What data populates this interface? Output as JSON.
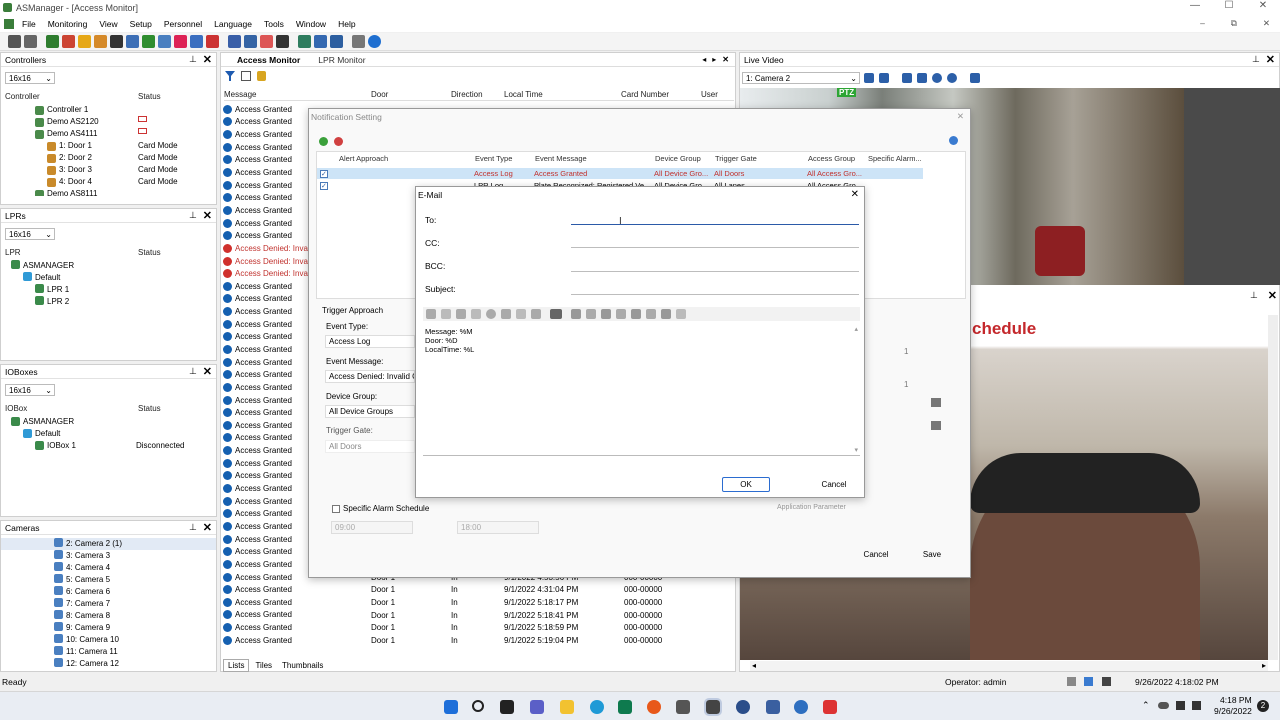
{
  "app": {
    "title": "ASManager - [Access Monitor]"
  },
  "menu": [
    "File",
    "Monitoring",
    "View",
    "Setup",
    "Personnel",
    "Language",
    "Tools",
    "Window",
    "Help"
  ],
  "controllers": {
    "title": "Controllers",
    "grid": "16x16",
    "col_controller": "Controller",
    "col_status": "Status",
    "items": [
      {
        "label": "Controller 1",
        "status": "",
        "indent": 1
      },
      {
        "label": "Demo AS2120",
        "status": "",
        "indent": 1
      },
      {
        "label": "Demo AS4111",
        "status": "",
        "indent": 1
      },
      {
        "label": "1: Door 1",
        "status": "Card Mode",
        "indent": 2
      },
      {
        "label": "2: Door 2",
        "status": "Card Mode",
        "indent": 2
      },
      {
        "label": "3: Door 3",
        "status": "Card Mode",
        "indent": 2
      },
      {
        "label": "4: Door 4",
        "status": "Card Mode",
        "indent": 2
      },
      {
        "label": "Demo AS8111",
        "status": "",
        "indent": 1
      }
    ]
  },
  "lprs": {
    "title": "LPRs",
    "grid": "16x16",
    "col_lpr": "LPR",
    "col_status": "Status",
    "items": [
      {
        "label": "ASMANAGER",
        "indent": 0
      },
      {
        "label": "Default",
        "indent": 1
      },
      {
        "label": "LPR 1",
        "indent": 2
      },
      {
        "label": "LPR 2",
        "indent": 2
      }
    ]
  },
  "ioboxes": {
    "title": "IOBoxes",
    "grid": "16x16",
    "col_io": "IOBox",
    "col_status": "Status",
    "items": [
      {
        "label": "ASMANAGER",
        "status": "",
        "indent": 0
      },
      {
        "label": "Default",
        "status": "",
        "indent": 1
      },
      {
        "label": "IOBox 1",
        "status": "Disconnected",
        "indent": 2
      }
    ]
  },
  "cameras": {
    "title": "Cameras",
    "items": [
      "2: Camera 2 (1)",
      "3: Camera 3",
      "4: Camera 4",
      "5: Camera 5",
      "6: Camera 6",
      "7: Camera 7",
      "8: Camera 8",
      "9: Camera 9",
      "10: Camera 10",
      "11: Camera 11",
      "12: Camera 12"
    ]
  },
  "monitor": {
    "tab_access": "Access Monitor",
    "tab_lpr": "LPR Monitor",
    "col_message": "Message",
    "col_door": "Door",
    "col_direction": "Direction",
    "col_time": "Local Time",
    "col_card": "Card Number",
    "col_user": "User",
    "bottom_tabs": [
      "Lists",
      "Tiles",
      "Thumbnails"
    ],
    "bottom_rows": [
      {
        "door": "Door 1",
        "dir": "In",
        "time": "9/1/2022 4:53:56 PM",
        "card": "000-00000"
      },
      {
        "door": "Door 1",
        "dir": "In",
        "time": "9/1/2022 4:31:04 PM",
        "card": "000-00000"
      },
      {
        "door": "Door 1",
        "dir": "In",
        "time": "9/1/2022 5:18:17 PM",
        "card": "000-00000"
      },
      {
        "door": "Door 1",
        "dir": "In",
        "time": "9/1/2022 5:18:41 PM",
        "card": "000-00000"
      },
      {
        "door": "Door 1",
        "dir": "In",
        "time": "9/1/2022 5:18:59 PM",
        "card": "000-00000"
      },
      {
        "door": "Door 1",
        "dir": "In",
        "time": "9/1/2022 5:19:04 PM",
        "card": "000-00000"
      }
    ]
  },
  "log_messages": [
    "Access Granted",
    "Access Granted",
    "Access Granted",
    "Access Granted",
    "Access Granted",
    "Access Granted",
    "Access Granted",
    "Access Granted",
    "Access Granted",
    "Access Granted",
    "Access Granted",
    "Access Denied: Invali",
    "Access Denied: Invali",
    "Access Denied: Invali",
    "Access Granted",
    "Access Granted",
    "Access Granted",
    "Access Granted",
    "Access Granted",
    "Access Granted",
    "Access Granted",
    "Access Granted",
    "Access Granted",
    "Access Granted",
    "Access Granted",
    "Access Granted",
    "Access Granted",
    "Access Granted",
    "Access Granted",
    "Access Granted",
    "Access Granted",
    "Access Granted",
    "Access Granted",
    "Access Granted",
    "Access Granted",
    "Access Granted",
    "Access Granted",
    "Access Granted",
    "Access Granted",
    "Access Granted",
    "Access Granted",
    "Access Granted",
    "Access Granted"
  ],
  "notification": {
    "title": "Notification Setting",
    "col_alert": "Alert Approach",
    "col_event_type": "Event Type",
    "col_event_msg": "Event Message",
    "col_device_group": "Device Group",
    "col_trigger_gate": "Trigger Gate",
    "col_access_group": "Access Group",
    "col_specific": "Specific Alarm...",
    "row1": {
      "event_type": "Access Log",
      "event_msg": "Access Granted",
      "device_group": "All Device Gro...",
      "trigger_gate": "All Doors",
      "access_group": "All Access Gro..."
    },
    "row2": {
      "event_type": "LPR Log",
      "event_msg": "Plate Recognized: Registered Ve...",
      "device_group": "All Device Gro...",
      "trigger_gate": "All Lanes",
      "access_group": "All Access Gro..."
    },
    "trigger_approach": "Trigger Approach",
    "event_type_label": "Event Type:",
    "event_type_value": "Access Log",
    "event_message_label": "Event Message:",
    "event_message_value": "Access Denied: Invalid Card",
    "device_group_label": "Device Group:",
    "device_group_value": "All Device Groups",
    "trigger_gate_label": "Trigger Gate:",
    "trigger_gate_value": "All Doors",
    "specific_schedule": "Specific Alarm Schedule",
    "time_from": "09:00",
    "time_to": "18:00",
    "app_param": "Application Parameter",
    "cancel": "Cancel",
    "save": "Save",
    "num1": "1",
    "num2": "1"
  },
  "email": {
    "title": "E-Mail",
    "to": "To:",
    "cc": "CC:",
    "bcc": "BCC:",
    "subject": "Subject:",
    "body": [
      "Message: %M",
      "Door: %D",
      "LocalTime: %L"
    ],
    "ok": "OK",
    "cancel": "Cancel"
  },
  "live": {
    "title": "Live Video",
    "camera": "1: Camera 2",
    "ptz": "PTZ",
    "overlay_text": "chedule"
  },
  "status": {
    "ready": "Ready",
    "operator": "Operator: admin",
    "datetime": "9/26/2022 4:18:02 PM"
  },
  "taskbar": {
    "time": "4:18 PM",
    "date": "9/26/2022"
  }
}
